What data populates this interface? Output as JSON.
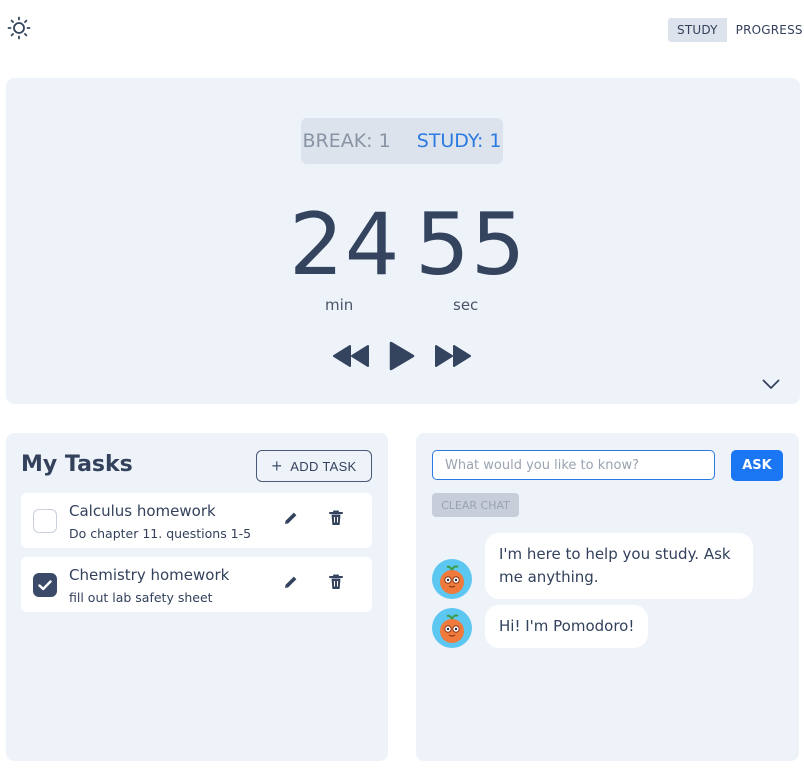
{
  "header": {
    "theme_icon": "sun-icon",
    "modes": [
      {
        "label": "STUDY",
        "active": true
      },
      {
        "label": "PROGRESS",
        "active": false
      }
    ]
  },
  "timer": {
    "break_label": "BREAK: 1",
    "study_label": "STUDY: 1",
    "minutes": "24",
    "seconds": "55",
    "min_unit": "min",
    "sec_unit": "sec",
    "controls": [
      "rewind-icon",
      "play-icon",
      "fast-forward-icon"
    ],
    "expand_icon": "chevron-down-icon"
  },
  "tasks": {
    "title": "My Tasks",
    "add_label": "ADD TASK",
    "items": [
      {
        "title": "Calculus homework",
        "subtitle": "Do chapter 11. questions 1-5",
        "done": false
      },
      {
        "title": "Chemistry homework",
        "subtitle": "fill out lab safety sheet",
        "done": true
      }
    ]
  },
  "chat": {
    "input_placeholder": "What would you like to know?",
    "ask_label": "ASK",
    "clear_label": "CLEAR CHAT",
    "messages": [
      {
        "text": "I'm here to help you study. Ask me anything."
      },
      {
        "text": "Hi! I'm Pomodoro!"
      }
    ]
  },
  "colors": {
    "accent": "#1a76f2",
    "study": "#2a7ae2",
    "card_bg": "#eef3fa",
    "text_dark": "#34435e"
  }
}
